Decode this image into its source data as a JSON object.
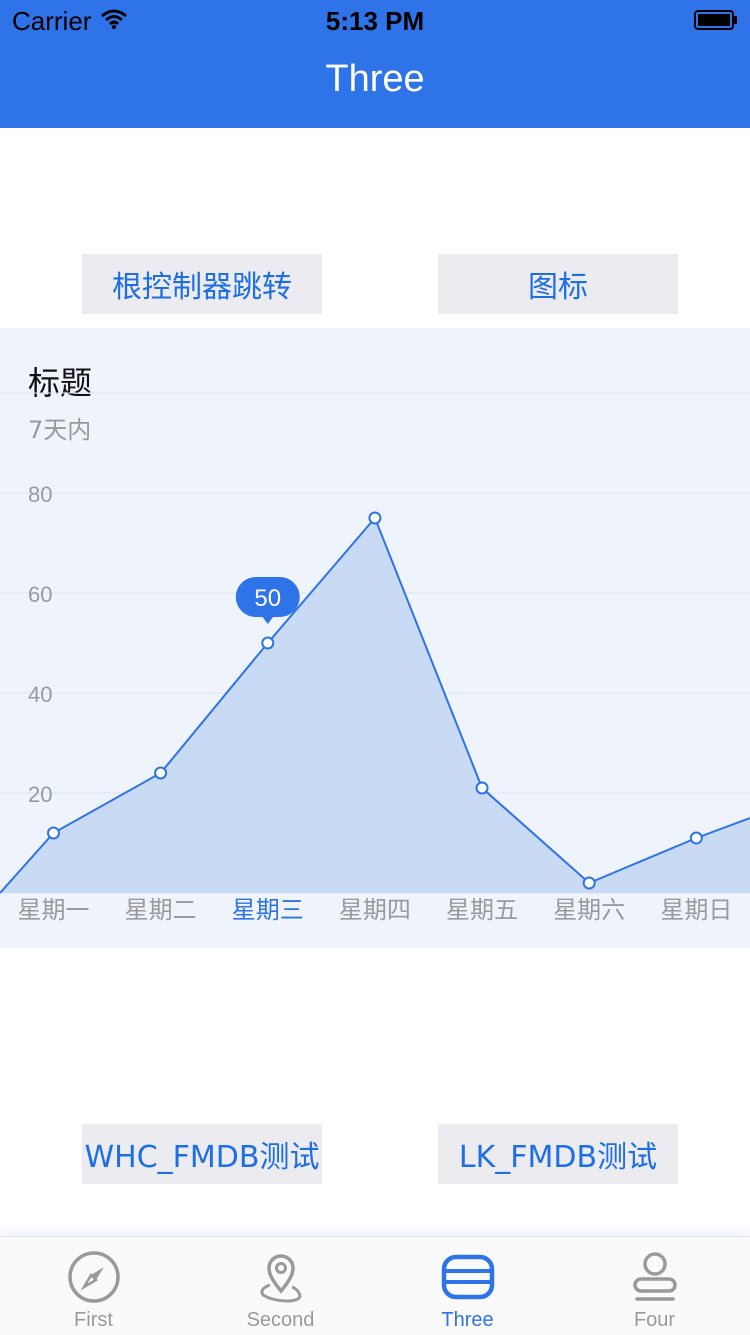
{
  "status_bar": {
    "carrier": "Carrier",
    "time": "5:13 PM"
  },
  "nav": {
    "title": "Three"
  },
  "buttons": {
    "root_controller_jump": "根控制器跳转",
    "icon": "图标",
    "whc_fmdb_test": "WHC_FMDB测试",
    "lk_fmdb_test": "LK_FMDB测试"
  },
  "chart_title": "标题",
  "chart_subtitle": "7天内",
  "chart_data": {
    "type": "area",
    "title": "标题",
    "subtitle": "7天内",
    "categories": [
      "星期一",
      "星期二",
      "星期三",
      "星期四",
      "星期五",
      "星期六",
      "星期日"
    ],
    "values": [
      12,
      24,
      50,
      75,
      21,
      2,
      11
    ],
    "y_ticks": [
      "20",
      "40",
      "60",
      "80"
    ],
    "ylim": [
      0,
      80
    ],
    "highlighted_index": 2,
    "highlight_label": "50",
    "grid": true,
    "colors": {
      "line": "#2f73e8",
      "fill": "#c9daf4",
      "tooltip": "#2f73e8"
    }
  },
  "tabs": [
    {
      "label": "First",
      "icon": "compass-icon",
      "active": false
    },
    {
      "label": "Second",
      "icon": "location-pin-icon",
      "active": false
    },
    {
      "label": "Three",
      "icon": "card-icon",
      "active": true
    },
    {
      "label": "Four",
      "icon": "person-icon",
      "active": false
    }
  ],
  "colors": {
    "accent": "#2f73e8",
    "button_bg": "#ebebf0",
    "chart_bg": "#eef3fc"
  }
}
